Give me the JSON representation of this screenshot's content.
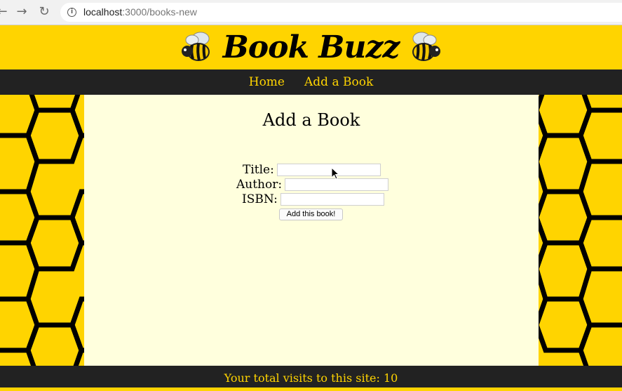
{
  "browser": {
    "url_host": "localhost",
    "url_path": ":3000/books-new"
  },
  "header": {
    "brand": "Book Buzz"
  },
  "nav": {
    "items": [
      {
        "label": "Home"
      },
      {
        "label": "Add a Book"
      }
    ]
  },
  "main": {
    "title": "Add a Book",
    "form": {
      "title_label": "Title:",
      "title_value": "",
      "author_label": "Author:",
      "author_value": "",
      "isbn_label": "ISBN:",
      "isbn_value": "",
      "submit_label": "Add this book!"
    }
  },
  "footer": {
    "visits_text": "Your total visits to this site:",
    "visits_count": "10"
  },
  "colors": {
    "brand_yellow": "#ffd400",
    "dark": "#222222",
    "content_bg": "#ffffdd"
  }
}
